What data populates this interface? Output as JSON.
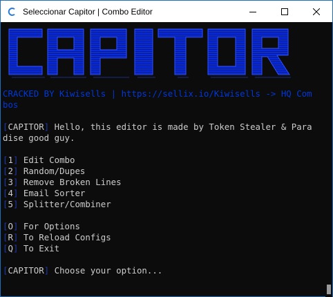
{
  "window": {
    "title": "Seleccionar Capitor | Combo Editor",
    "minimize_icon": "minimize-icon",
    "maximize_icon": "maximize-icon",
    "close_icon": "close-icon"
  },
  "console": {
    "banner_text": "CAPITOR",
    "credit_line1": "CRACKED BY Kiwisells | https://sellix.io/Kiwisells -> HQ Com",
    "credit_line2": "bos",
    "hello_tag": "CAPITOR",
    "hello_line1": " Hello, this editor is made by Token Stealer & Para",
    "hello_line2": "dise good guy.",
    "menu": [
      {
        "key": "1",
        "label": " Edit Combo"
      },
      {
        "key": "2",
        "label": " Random/Dupes"
      },
      {
        "key": "3",
        "label": " Remove Broken Lines"
      },
      {
        "key": "4",
        "label": " Email Sorter"
      },
      {
        "key": "5",
        "label": " Splitter/Combiner"
      }
    ],
    "extra": [
      {
        "key": "O",
        "label": " For Options"
      },
      {
        "key": "R",
        "label": " To Reload Configs"
      },
      {
        "key": "Q",
        "label": " To Exit"
      }
    ],
    "prompt_tag": "CAPITOR",
    "prompt_text": " Choose your option..."
  },
  "colors": {
    "banner": "#0a2bd8",
    "accent_blue": "#0037da",
    "text": "#cccccc",
    "background": "#0c0c0c"
  }
}
